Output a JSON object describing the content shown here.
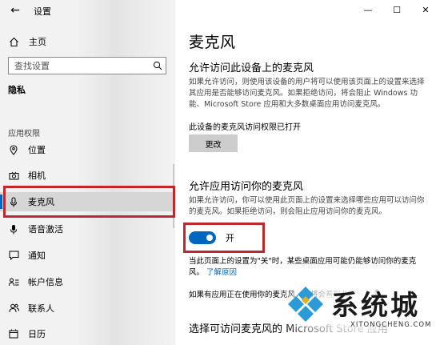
{
  "window": {
    "title": "设置",
    "controls": {
      "minimize": "—",
      "maximize": "☐",
      "close": "✕"
    }
  },
  "sidebar": {
    "back_icon": "←",
    "home_label": "主页",
    "search_placeholder": "查找设置",
    "section_privacy": "隐私",
    "section_app_permissions": "应用权限",
    "items": [
      {
        "label": "位置",
        "icon": "location-icon"
      },
      {
        "label": "相机",
        "icon": "camera-icon"
      },
      {
        "label": "麦克风",
        "icon": "microphone-icon",
        "selected": true
      },
      {
        "label": "语音激活",
        "icon": "voice-activation-icon"
      },
      {
        "label": "通知",
        "icon": "notification-icon"
      },
      {
        "label": "帐户信息",
        "icon": "account-info-icon"
      },
      {
        "label": "联系人",
        "icon": "contacts-icon"
      },
      {
        "label": "日历",
        "icon": "calendar-icon"
      }
    ]
  },
  "main": {
    "title": "麦克风",
    "section1": {
      "heading": "允许访问此设备上的麦克风",
      "description": "如果允许访问，则使用该设备的用户将可以使用该页面上的设置来选择其应用是否能够访问麦克风。如果拒绝访问，将会阻止 Windows 功能、Microsoft Store 应用和大多数桌面应用访问麦克风。",
      "status": "此设备的麦克风访问权限已打开",
      "change_button": "更改"
    },
    "section2": {
      "heading": "允许应用访问你的麦克风",
      "description": "如果允许访问，你可以使用此页面上的设置来选择哪些应用可以访问你的麦克风。如果拒绝访问，则会阻止应用访问你的麦克风。",
      "toggle_state": "开",
      "toggle_on": true,
      "note_text": "当此页面上的设置为\"关\"时，某些桌面应用可能仍能够访问你的麦克风。",
      "note_link": "了解原因",
      "note2": "如果有应用正在使用你的麦克风，你将会看到此图标："
    },
    "section3": {
      "heading": "选择可访问麦克风的 Microsoft Store 应用"
    }
  },
  "watermark": {
    "text": "系统城",
    "subtext": "XITONGCHENG.COM"
  },
  "colors": {
    "accent": "#0067c0",
    "highlight_box": "#c0282d",
    "sidebar_bg": "#f2f2f2"
  }
}
